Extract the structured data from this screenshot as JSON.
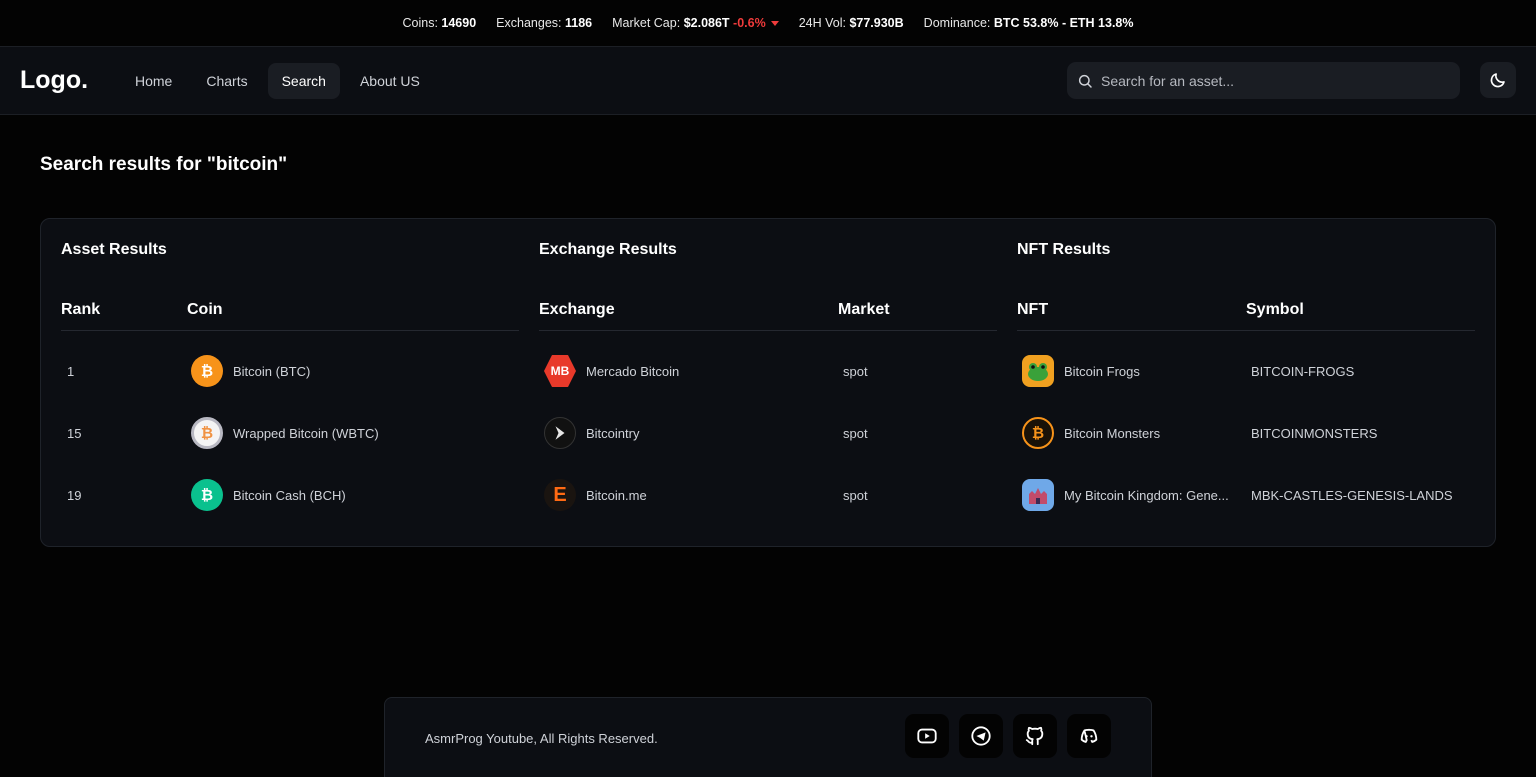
{
  "ticker": {
    "coins_label": "Coins:",
    "coins_value": "14690",
    "exchanges_label": "Exchanges:",
    "exchanges_value": "1186",
    "market_cap_label": "Market Cap:",
    "market_cap_value": "$2.086T",
    "market_cap_change": "-0.6%",
    "vol_label": "24H Vol:",
    "vol_value": "$77.930B",
    "dominance_label": "Dominance:",
    "dominance_value": "BTC 53.8% - ETH 13.8%",
    "negative_color": "#ef3b3b"
  },
  "navbar": {
    "logo": "Logo.",
    "links": [
      {
        "label": "Home"
      },
      {
        "label": "Charts"
      },
      {
        "label": "Search",
        "active": true
      },
      {
        "label": "About US"
      }
    ],
    "search_placeholder": "Search for an asset...",
    "theme_icon": "moon-icon"
  },
  "page_title": "Search results for \"bitcoin\"",
  "assets": {
    "heading": "Asset Results",
    "columns": [
      "Rank",
      "Coin"
    ],
    "rows": [
      {
        "rank": "1",
        "coin": "Bitcoin (BTC)",
        "icon": "bitcoin-icon",
        "color": "#f7931a"
      },
      {
        "rank": "15",
        "coin": "Wrapped Bitcoin (WBTC)",
        "icon": "wrapped-bitcoin-icon",
        "color": "#f09242"
      },
      {
        "rank": "19",
        "coin": "Bitcoin Cash (BCH)",
        "icon": "bitcoin-cash-icon",
        "color": "#0ac18e"
      }
    ]
  },
  "exchanges": {
    "heading": "Exchange Results",
    "columns": [
      "Exchange",
      "Market"
    ],
    "rows": [
      {
        "name": "Mercado Bitcoin",
        "market": "spot",
        "icon": "mercado-bitcoin-logo",
        "color": "#e8392a"
      },
      {
        "name": "Bitcointry",
        "market": "spot",
        "icon": "bitcointry-logo",
        "color": "#111111"
      },
      {
        "name": "Bitcoin.me",
        "market": "spot",
        "icon": "bitcoin-me-logo",
        "color": "#ff6a13"
      }
    ]
  },
  "nfts": {
    "heading": "NFT Results",
    "columns": [
      "NFT",
      "Symbol"
    ],
    "rows": [
      {
        "name": "Bitcoin Frogs",
        "symbol": "BITCOIN-FROGS",
        "icon": "bitcoin-frogs-image"
      },
      {
        "name": "Bitcoin Monsters",
        "symbol": "BITCOINMONSTERS",
        "icon": "bitcoin-monsters-image"
      },
      {
        "name": "My Bitcoin Kingdom: Gene...",
        "symbol": "MBK-CASTLES-GENESIS-LANDS",
        "icon": "mbk-castles-image"
      }
    ]
  },
  "footer": {
    "copyright": "AsmrProg Youtube, All Rights Reserved.",
    "socials": [
      "youtube-icon",
      "telegram-icon",
      "github-icon",
      "discord-icon"
    ]
  }
}
